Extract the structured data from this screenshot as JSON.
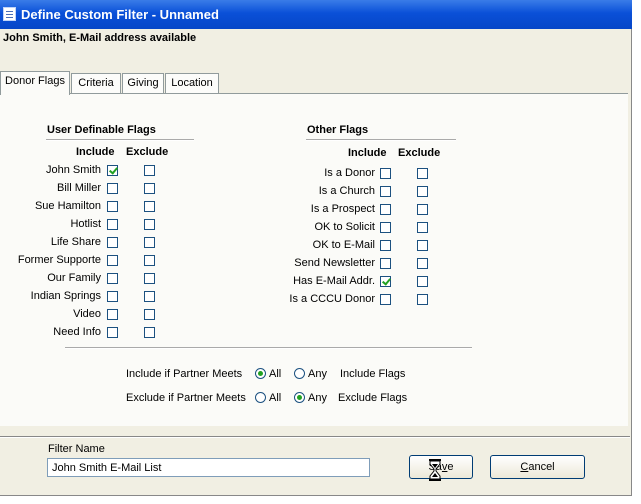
{
  "window": {
    "title": "Define Custom Filter - Unnamed"
  },
  "header": {
    "text": "John Smith, E-Mail address available"
  },
  "tabs": [
    {
      "label": "Donor Flags",
      "active": true
    },
    {
      "label": "Criteria",
      "active": false
    },
    {
      "label": "Giving",
      "active": false
    },
    {
      "label": "Location",
      "active": false
    }
  ],
  "user_flags": {
    "title": "User Definable Flags",
    "include_header": "Include",
    "exclude_header": "Exclude",
    "rows": [
      {
        "label": "John Smith",
        "include": true,
        "exclude": false
      },
      {
        "label": "Bill Miller",
        "include": false,
        "exclude": false
      },
      {
        "label": "Sue Hamilton",
        "include": false,
        "exclude": false
      },
      {
        "label": "Hotlist",
        "include": false,
        "exclude": false
      },
      {
        "label": "Life Share",
        "include": false,
        "exclude": false
      },
      {
        "label": "Former Supporte",
        "include": false,
        "exclude": false
      },
      {
        "label": "Our Family",
        "include": false,
        "exclude": false
      },
      {
        "label": "Indian Springs",
        "include": false,
        "exclude": false
      },
      {
        "label": "Video",
        "include": false,
        "exclude": false
      },
      {
        "label": "Need Info",
        "include": false,
        "exclude": false
      }
    ]
  },
  "other_flags": {
    "title": "Other Flags",
    "include_header": "Include",
    "exclude_header": "Exclude",
    "rows": [
      {
        "label": "Is a Donor",
        "include": false,
        "exclude": false
      },
      {
        "label": "Is a Church",
        "include": false,
        "exclude": false
      },
      {
        "label": "Is a Prospect",
        "include": false,
        "exclude": false
      },
      {
        "label": "OK to Solicit",
        "include": false,
        "exclude": false
      },
      {
        "label": "OK to E-Mail",
        "include": false,
        "exclude": false
      },
      {
        "label": "Send Newsletter",
        "include": false,
        "exclude": false
      },
      {
        "label": "Has E-Mail Addr.",
        "include": true,
        "exclude": false
      },
      {
        "label": "Is a CCCU Donor",
        "include": false,
        "exclude": false
      }
    ]
  },
  "match_options": {
    "include": {
      "label": "Include if Partner Meets",
      "all_label": "All",
      "any_label": "Any",
      "suffix": "Include Flags",
      "selected": "All"
    },
    "exclude": {
      "label": "Exclude if Partner Meets",
      "all_label": "All",
      "any_label": "Any",
      "suffix": "Exclude Flags",
      "selected": "Any"
    }
  },
  "filter_name": {
    "label": "Filter Name",
    "value": "John Smith E-Mail List"
  },
  "buttons": {
    "save": {
      "pre": "Sa",
      "underline": "v",
      "post": "e"
    },
    "cancel": {
      "pre": "",
      "underline": "C",
      "post": "ancel"
    }
  },
  "colors": {
    "titlebar": "#0a50d8",
    "check": "#21a121",
    "window_bg": "#f1efe3"
  },
  "icons": {
    "system_menu": "document-icon",
    "cursor": "hourglass-icon"
  }
}
